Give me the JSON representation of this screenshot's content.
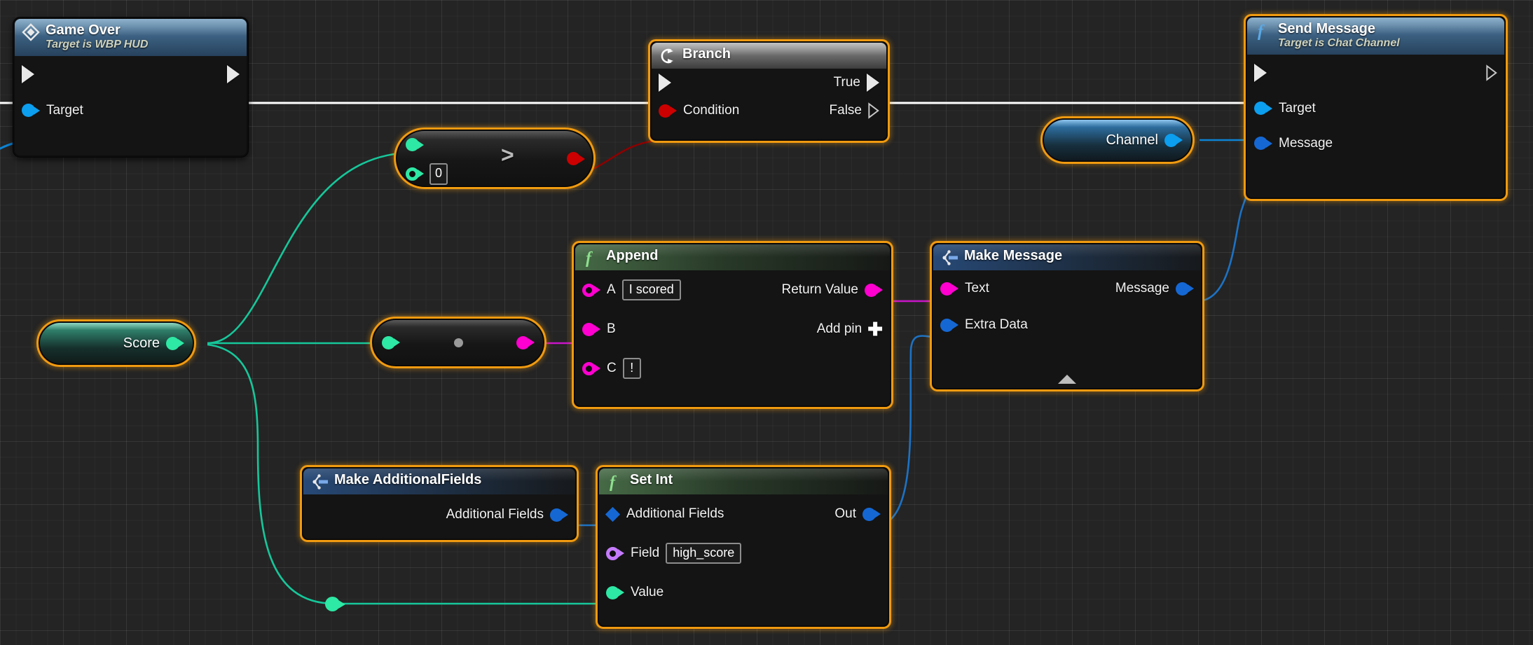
{
  "app": {
    "context": "Unreal Engine Blueprint Event Graph"
  },
  "colors": {
    "selection": "#f09a10",
    "exec_wire": "#ffffff",
    "bool_wire": "#8c0000",
    "bool_pin": "#cc0000",
    "string_pin": "#ff00d0",
    "int_pin": "#2ee8a5",
    "object_pin": "#0099ee",
    "struct_pin": "#1568d4",
    "name_pin": "#c57bff",
    "background": "#242424"
  },
  "nodes": {
    "game_over": {
      "title": "Game Over",
      "subtitle": "Target is WBP HUD",
      "icon": "event-diamond-icon",
      "pins": {
        "target": "Target"
      }
    },
    "branch": {
      "title": "Branch",
      "icon": "branch-icon",
      "pins": {
        "condition": "Condition",
        "true": "True",
        "false": "False"
      }
    },
    "send_message": {
      "title": "Send Message",
      "subtitle": "Target is Chat Channel",
      "icon": "function-f-icon",
      "pins": {
        "target": "Target",
        "message": "Message"
      }
    },
    "greater_than": {
      "operator": ">",
      "b_value": "0"
    },
    "to_string": {
      "operator": ""
    },
    "score_var": {
      "label": "Score"
    },
    "channel_var": {
      "label": "Channel"
    },
    "append": {
      "title": "Append",
      "icon": "function-f-icon",
      "pins": {
        "a": "A",
        "b": "B",
        "c": "C",
        "return_value": "Return Value"
      },
      "values": {
        "a": "I scored",
        "c": "!"
      },
      "add_pin_label": "Add pin"
    },
    "make_message": {
      "title": "Make Message",
      "icon": "make-struct-icon",
      "pins": {
        "text": "Text",
        "extra_data": "Extra Data",
        "message": "Message"
      }
    },
    "make_additional_fields": {
      "title": "Make AdditionalFields",
      "icon": "make-struct-icon",
      "pins": {
        "additional_fields": "Additional Fields"
      }
    },
    "set_int": {
      "title": "Set Int",
      "icon": "function-f-icon",
      "pins": {
        "additional_fields": "Additional Fields",
        "field": "Field",
        "value": "Value",
        "out": "Out"
      },
      "values": {
        "field": "high_score"
      }
    }
  }
}
